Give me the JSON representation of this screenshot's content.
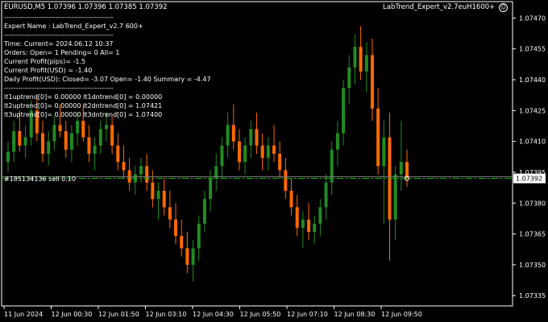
{
  "header": {
    "symbol_line": "EURUSD,M5  1.07396 1.07396 1.07385 1.07392",
    "ea_name": "LabTrend_Expert_v2.7euH1600+",
    "smiley_icon": "smiley-icon"
  },
  "info_panel": {
    "lines": [
      "-----------------------------------------------",
      "Expert Name : LabTrend_Expert_v2.7 600+",
      "-----------------------------------------------",
      "Time: Current= 2024.06.12 10:37",
      "Orders: Open= 1 Pending= 0 All= 1",
      "Current Profit(pips)= -1.5",
      "Current Profit(USD) = -1.40",
      "Daily Profit(USD): Closed= -3.07 Open= -1.40 Summary = -4.47",
      "-----------------------------------------------",
      "lt1uptrend[0]= 0.00000 lt1dntrend[0] = 0.00000",
      "lt2uptrend[0]= 0.00000 lt2dntrend[0] = 1.07421",
      "lt3uptrend[0]= 0.00000 lt3dntrend[0] = 1.07400"
    ]
  },
  "order_label": "#185134136 sell 0.10",
  "current_price_label": "1.07392",
  "colors": {
    "background": "#000000",
    "bull_candle": "#228B22",
    "bear_candle": "#FF6A00",
    "grid_line": "#3a3a3a",
    "order_line": "#00C000",
    "bid_line": "#808080"
  },
  "chart_data": {
    "type": "candlestick",
    "symbol": "EURUSD",
    "timeframe": "M5",
    "ylim": [
      1.0733,
      1.07478
    ],
    "y_ticks": [
      "1.07470",
      "1.07455",
      "1.07440",
      "1.07425",
      "1.07410",
      "1.07395",
      "1.07380",
      "1.07365",
      "1.07350",
      "1.07335"
    ],
    "y_tick_values": [
      1.0747,
      1.07455,
      1.0744,
      1.07425,
      1.0741,
      1.07395,
      1.0738,
      1.07365,
      1.0735,
      1.07335
    ],
    "x_ticks": [
      "11 Jun 2024",
      "12 Jun 00:30",
      "12 Jun 01:50",
      "12 Jun 03:10",
      "12 Jun 04:30",
      "12 Jun 05:50",
      "12 Jun 07:10",
      "12 Jun 08:30",
      "12 Jun 09:50"
    ],
    "last": {
      "open": 1.07396,
      "high": 1.07396,
      "low": 1.07385,
      "close": 1.07392
    },
    "order_price": 1.07392,
    "order_type": "sell",
    "order_volume": 0.1,
    "candles": [
      [
        1.074,
        1.0741,
        1.07395,
        1.07405
      ],
      [
        1.07405,
        1.0742,
        1.074,
        1.07415
      ],
      [
        1.07415,
        1.07425,
        1.07405,
        1.07408
      ],
      [
        1.07408,
        1.07418,
        1.07402,
        1.07412
      ],
      [
        1.07412,
        1.0743,
        1.07408,
        1.07425
      ],
      [
        1.07425,
        1.07432,
        1.0741,
        1.07414
      ],
      [
        1.07414,
        1.0742,
        1.074,
        1.07404
      ],
      [
        1.07404,
        1.07415,
        1.07398,
        1.0741
      ],
      [
        1.0741,
        1.07422,
        1.07406,
        1.07418
      ],
      [
        1.07418,
        1.07428,
        1.07412,
        1.07415
      ],
      [
        1.07415,
        1.0742,
        1.07402,
        1.07406
      ],
      [
        1.07406,
        1.07418,
        1.074,
        1.07414
      ],
      [
        1.07414,
        1.07424,
        1.07408,
        1.0742
      ],
      [
        1.0742,
        1.07428,
        1.0741,
        1.07412
      ],
      [
        1.07412,
        1.07418,
        1.074,
        1.07404
      ],
      [
        1.07404,
        1.07412,
        1.07396,
        1.07408
      ],
      [
        1.07408,
        1.0742,
        1.07404,
        1.07416
      ],
      [
        1.07416,
        1.07424,
        1.0741,
        1.07418
      ],
      [
        1.07418,
        1.07422,
        1.07404,
        1.07408
      ],
      [
        1.07408,
        1.07414,
        1.07396,
        1.074
      ],
      [
        1.074,
        1.07408,
        1.07392,
        1.07396
      ],
      [
        1.07396,
        1.07402,
        1.07386,
        1.0739
      ],
      [
        1.0739,
        1.07398,
        1.07384,
        1.07394
      ],
      [
        1.07394,
        1.07402,
        1.0739,
        1.07398
      ],
      [
        1.07398,
        1.07404,
        1.07386,
        1.0739
      ],
      [
        1.0739,
        1.07396,
        1.07378,
        1.07382
      ],
      [
        1.07382,
        1.0739,
        1.07372,
        1.07386
      ],
      [
        1.07386,
        1.07392,
        1.07374,
        1.07378
      ],
      [
        1.07378,
        1.07386,
        1.07368,
        1.07372
      ],
      [
        1.07372,
        1.0738,
        1.0736,
        1.07364
      ],
      [
        1.07364,
        1.07372,
        1.07354,
        1.07358
      ],
      [
        1.07358,
        1.07366,
        1.07346,
        1.0735
      ],
      [
        1.0735,
        1.07362,
        1.07342,
        1.07358
      ],
      [
        1.07358,
        1.07374,
        1.07352,
        1.0737
      ],
      [
        1.0737,
        1.07386,
        1.07366,
        1.07382
      ],
      [
        1.07382,
        1.07396,
        1.07376,
        1.07392
      ],
      [
        1.07392,
        1.07404,
        1.07386,
        1.07398
      ],
      [
        1.07398,
        1.07412,
        1.07392,
        1.07408
      ],
      [
        1.07408,
        1.07424,
        1.07402,
        1.07418
      ],
      [
        1.07418,
        1.07428,
        1.07406,
        1.0741
      ],
      [
        1.0741,
        1.07416,
        1.07396,
        1.074
      ],
      [
        1.074,
        1.07412,
        1.07394,
        1.07408
      ],
      [
        1.07408,
        1.0742,
        1.07402,
        1.07416
      ],
      [
        1.07416,
        1.07424,
        1.07404,
        1.07408
      ],
      [
        1.07408,
        1.07414,
        1.07396,
        1.07402
      ],
      [
        1.07402,
        1.07412,
        1.07396,
        1.07408
      ],
      [
        1.07408,
        1.07418,
        1.074,
        1.07404
      ],
      [
        1.07404,
        1.0741,
        1.07392,
        1.07396
      ],
      [
        1.07396,
        1.07402,
        1.07382,
        1.07386
      ],
      [
        1.07386,
        1.07392,
        1.07374,
        1.07378
      ],
      [
        1.07378,
        1.07384,
        1.07364,
        1.07368
      ],
      [
        1.07368,
        1.07376,
        1.07358,
        1.07372
      ],
      [
        1.07372,
        1.0738,
        1.07362,
        1.07366
      ],
      [
        1.07366,
        1.07374,
        1.0736,
        1.0737
      ],
      [
        1.0737,
        1.07382,
        1.07364,
        1.07378
      ],
      [
        1.07378,
        1.07394,
        1.07372,
        1.0739
      ],
      [
        1.0739,
        1.0741,
        1.07384,
        1.07406
      ],
      [
        1.07406,
        1.0742,
        1.07398,
        1.07414
      ],
      [
        1.07414,
        1.0744,
        1.07408,
        1.07436
      ],
      [
        1.07436,
        1.07452,
        1.07428,
        1.07446
      ],
      [
        1.07446,
        1.07462,
        1.07438,
        1.07456
      ],
      [
        1.07456,
        1.07466,
        1.0744,
        1.07444
      ],
      [
        1.07444,
        1.07458,
        1.07434,
        1.07452
      ],
      [
        1.07452,
        1.0746,
        1.0742,
        1.07426
      ],
      [
        1.07426,
        1.07436,
        1.07394,
        1.07398
      ],
      [
        1.07398,
        1.0742,
        1.0737,
        1.07412
      ],
      [
        1.07412,
        1.07424,
        1.07352,
        1.07372
      ],
      [
        1.07372,
        1.07398,
        1.07362,
        1.07394
      ],
      [
        1.07394,
        1.0742,
        1.07386,
        1.074
      ],
      [
        1.074,
        1.07406,
        1.07388,
        1.07392
      ]
    ]
  }
}
